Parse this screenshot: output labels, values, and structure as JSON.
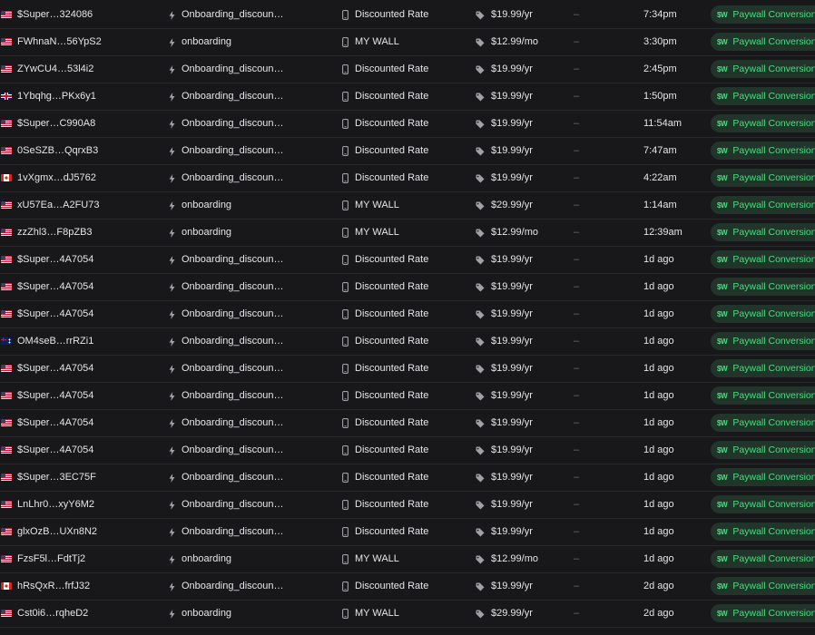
{
  "badge": {
    "logo": "$W",
    "label": "Paywall Conversion",
    "color": "#4ade80",
    "background": "#21352b"
  },
  "icons": {
    "campaign": "bolt-icon",
    "paywall": "phone-icon",
    "price": "tag-icon"
  },
  "rows": [
    {
      "flag": "us",
      "user": "$Super…324086",
      "campaign": "Onboarding_discoun…",
      "paywall": "Discounted Rate",
      "price": "$19.99/yr",
      "extra": "–",
      "time": "7:34pm"
    },
    {
      "flag": "us",
      "user": "FWhnaN…56YpS2",
      "campaign": "onboarding",
      "paywall": "MY WALL",
      "price": "$12.99/mo",
      "extra": "–",
      "time": "3:30pm"
    },
    {
      "flag": "us",
      "user": "ZYwCU4…53l4i2",
      "campaign": "Onboarding_discoun…",
      "paywall": "Discounted Rate",
      "price": "$19.99/yr",
      "extra": "–",
      "time": "2:45pm"
    },
    {
      "flag": "gb",
      "user": "1Ybqhg…PKx6y1",
      "campaign": "Onboarding_discoun…",
      "paywall": "Discounted Rate",
      "price": "$19.99/yr",
      "extra": "–",
      "time": "1:50pm"
    },
    {
      "flag": "us",
      "user": "$Super…C990A8",
      "campaign": "Onboarding_discoun…",
      "paywall": "Discounted Rate",
      "price": "$19.99/yr",
      "extra": "–",
      "time": "11:54am"
    },
    {
      "flag": "us",
      "user": "0SeSZB…QqrxB3",
      "campaign": "Onboarding_discoun…",
      "paywall": "Discounted Rate",
      "price": "$19.99/yr",
      "extra": "–",
      "time": "7:47am"
    },
    {
      "flag": "ca",
      "user": "1vXgmx…dJ5762",
      "campaign": "Onboarding_discoun…",
      "paywall": "Discounted Rate",
      "price": "$19.99/yr",
      "extra": "–",
      "time": "4:22am"
    },
    {
      "flag": "us",
      "user": "xU57Ea…A2FU73",
      "campaign": "onboarding",
      "paywall": "MY WALL",
      "price": "$29.99/yr",
      "extra": "–",
      "time": "1:14am"
    },
    {
      "flag": "us",
      "user": "zzZhl3…F8pZB3",
      "campaign": "onboarding",
      "paywall": "MY WALL",
      "price": "$12.99/mo",
      "extra": "–",
      "time": "12:39am"
    },
    {
      "flag": "us",
      "user": "$Super…4A7054",
      "campaign": "Onboarding_discoun…",
      "paywall": "Discounted Rate",
      "price": "$19.99/yr",
      "extra": "–",
      "time": "1d ago"
    },
    {
      "flag": "us",
      "user": "$Super…4A7054",
      "campaign": "Onboarding_discoun…",
      "paywall": "Discounted Rate",
      "price": "$19.99/yr",
      "extra": "–",
      "time": "1d ago"
    },
    {
      "flag": "us",
      "user": "$Super…4A7054",
      "campaign": "Onboarding_discoun…",
      "paywall": "Discounted Rate",
      "price": "$19.99/yr",
      "extra": "–",
      "time": "1d ago"
    },
    {
      "flag": "au",
      "user": "OM4seB…rrRZi1",
      "campaign": "Onboarding_discoun…",
      "paywall": "Discounted Rate",
      "price": "$19.99/yr",
      "extra": "–",
      "time": "1d ago"
    },
    {
      "flag": "us",
      "user": "$Super…4A7054",
      "campaign": "Onboarding_discoun…",
      "paywall": "Discounted Rate",
      "price": "$19.99/yr",
      "extra": "–",
      "time": "1d ago"
    },
    {
      "flag": "us",
      "user": "$Super…4A7054",
      "campaign": "Onboarding_discoun…",
      "paywall": "Discounted Rate",
      "price": "$19.99/yr",
      "extra": "–",
      "time": "1d ago"
    },
    {
      "flag": "us",
      "user": "$Super…4A7054",
      "campaign": "Onboarding_discoun…",
      "paywall": "Discounted Rate",
      "price": "$19.99/yr",
      "extra": "–",
      "time": "1d ago"
    },
    {
      "flag": "us",
      "user": "$Super…4A7054",
      "campaign": "Onboarding_discoun…",
      "paywall": "Discounted Rate",
      "price": "$19.99/yr",
      "extra": "–",
      "time": "1d ago"
    },
    {
      "flag": "us",
      "user": "$Super…3EC75F",
      "campaign": "Onboarding_discoun…",
      "paywall": "Discounted Rate",
      "price": "$19.99/yr",
      "extra": "–",
      "time": "1d ago"
    },
    {
      "flag": "us",
      "user": "LnLhr0…xyY6M2",
      "campaign": "Onboarding_discoun…",
      "paywall": "Discounted Rate",
      "price": "$19.99/yr",
      "extra": "–",
      "time": "1d ago"
    },
    {
      "flag": "us",
      "user": "glxOzB…UXn8N2",
      "campaign": "Onboarding_discoun…",
      "paywall": "Discounted Rate",
      "price": "$19.99/yr",
      "extra": "–",
      "time": "1d ago"
    },
    {
      "flag": "us",
      "user": "FzsF5l…FdtTj2",
      "campaign": "onboarding",
      "paywall": "MY WALL",
      "price": "$12.99/mo",
      "extra": "–",
      "time": "1d ago"
    },
    {
      "flag": "ca",
      "user": "hRsQxR…frfJ32",
      "campaign": "Onboarding_discoun…",
      "paywall": "Discounted Rate",
      "price": "$19.99/yr",
      "extra": "–",
      "time": "2d ago"
    },
    {
      "flag": "us",
      "user": "Cst0i6…rqheD2",
      "campaign": "onboarding",
      "paywall": "MY WALL",
      "price": "$29.99/yr",
      "extra": "–",
      "time": "2d ago"
    }
  ]
}
